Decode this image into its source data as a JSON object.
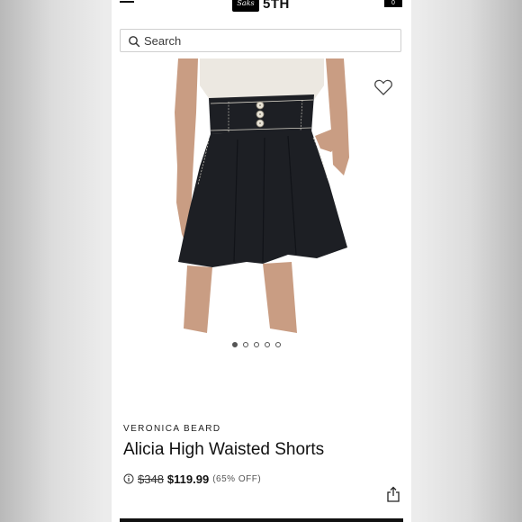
{
  "header": {
    "logo_script": "Saks",
    "logo_text": "5TH",
    "cart_count": "0"
  },
  "search": {
    "placeholder": "Search"
  },
  "product": {
    "brand": "VERONICA BEARD",
    "title": "Alicia High Waisted Shorts",
    "original_price": "$348",
    "sale_price": "$119.99",
    "discount": "(65% OFF)"
  },
  "carousel": {
    "total_images": 5,
    "active_index": 0
  },
  "icons": {
    "menu": "hamburger-menu-icon",
    "search": "search-icon",
    "favorite": "heart-icon",
    "info": "info-icon",
    "share": "share-icon",
    "cart": "shopping-bag-icon"
  },
  "colors": {
    "text": "#111111",
    "shorts": "#1d1f24",
    "stitching": "#d8d4c9",
    "top": "#ece8e1"
  }
}
